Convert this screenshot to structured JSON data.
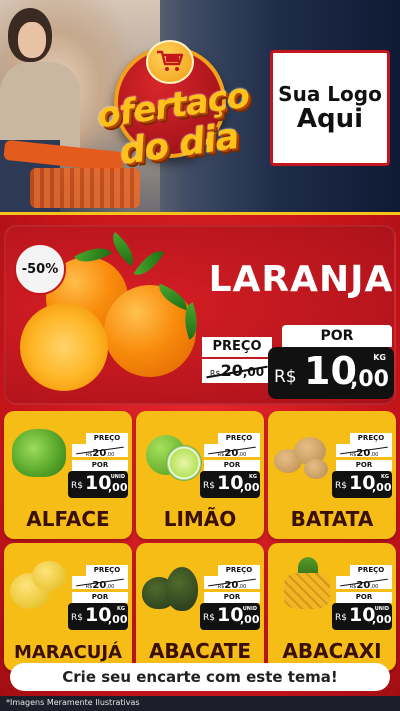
{
  "header": {
    "logo_line1": "ofertaço",
    "logo_line2": "do dia",
    "placeholder_logo_line1": "Sua Logo",
    "placeholder_logo_line2": "Aqui"
  },
  "featured": {
    "discount": "-50%",
    "name": "LARANJA",
    "preco_label": "PREÇO",
    "old_currency": "R$",
    "old_price": "20",
    "old_cents": ",00",
    "por_label": "POR",
    "new_currency": "R$",
    "new_price": "10",
    "new_cents": ",00",
    "unit": "KG"
  },
  "products": [
    {
      "name": "ALFACE",
      "preco_label": "PREÇO",
      "old_currency": "R$",
      "old_price": "20",
      "old_cents": ",00",
      "por_label": "POR",
      "new_currency": "R$",
      "new_price": "10",
      "new_cents": ",00",
      "unit": "UNID"
    },
    {
      "name": "LIMÃO",
      "preco_label": "PREÇO",
      "old_currency": "R$",
      "old_price": "20",
      "old_cents": ",00",
      "por_label": "POR",
      "new_currency": "R$",
      "new_price": "10",
      "new_cents": ",00",
      "unit": "KG"
    },
    {
      "name": "BATATA",
      "preco_label": "PREÇO",
      "old_currency": "R$",
      "old_price": "20",
      "old_cents": ",00",
      "por_label": "POR",
      "new_currency": "R$",
      "new_price": "10",
      "new_cents": ",00",
      "unit": "KG"
    },
    {
      "name": "MARACUJÁ",
      "preco_label": "PREÇO",
      "old_currency": "R$",
      "old_price": "20",
      "old_cents": ",00",
      "por_label": "POR",
      "new_currency": "R$",
      "new_price": "10",
      "new_cents": ",00",
      "unit": "KG"
    },
    {
      "name": "ABACATE",
      "preco_label": "PREÇO",
      "old_currency": "R$",
      "old_price": "20",
      "old_cents": ",00",
      "por_label": "POR",
      "new_currency": "R$",
      "new_price": "10",
      "new_cents": ",00",
      "unit": "UNID"
    },
    {
      "name": "ABACAXI",
      "preco_label": "PREÇO",
      "old_currency": "R$",
      "old_price": "20",
      "old_cents": ",00",
      "por_label": "POR",
      "new_currency": "R$",
      "new_price": "10",
      "new_cents": ",00",
      "unit": "UNID"
    }
  ],
  "cta": "Crie seu encarte com este tema!",
  "footer_note": "*Imagens Meramente Ilustrativas",
  "colors": {
    "red": "#c4161c",
    "yellow": "#f6bd16",
    "dark": "#111111"
  },
  "icons": [
    "shopping-cart-icon"
  ]
}
